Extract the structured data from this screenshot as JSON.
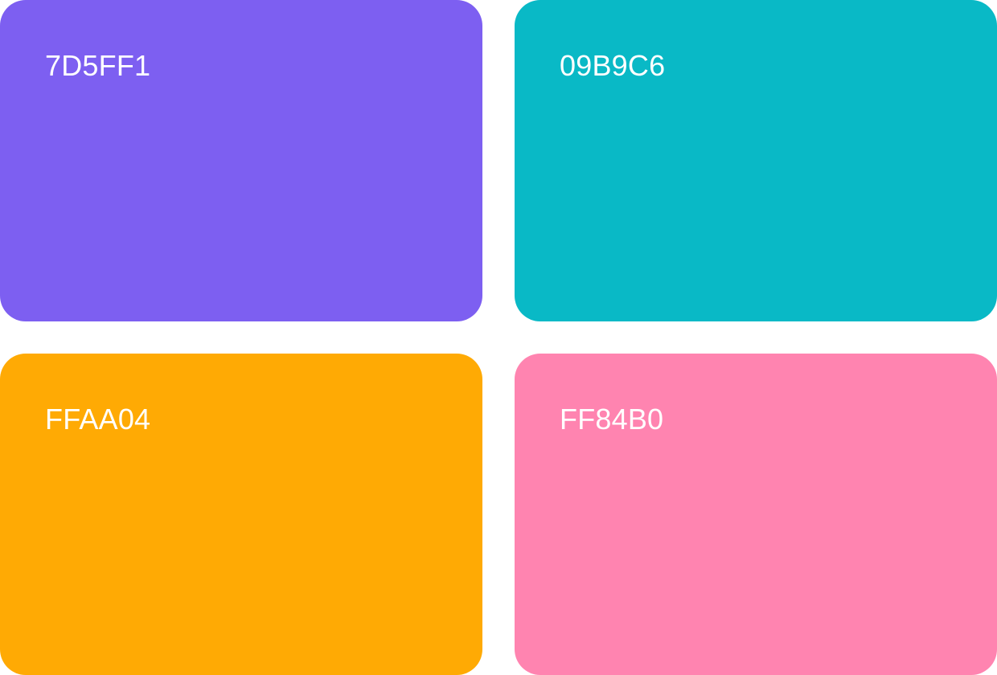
{
  "swatches": [
    {
      "label": "7D5FF1",
      "color": "#7D5FF1"
    },
    {
      "label": "09B9C6",
      "color": "#09B9C6"
    },
    {
      "label": "FFAA04",
      "color": "#FFAA04"
    },
    {
      "label": "FF84B0",
      "color": "#FF84B0"
    }
  ]
}
